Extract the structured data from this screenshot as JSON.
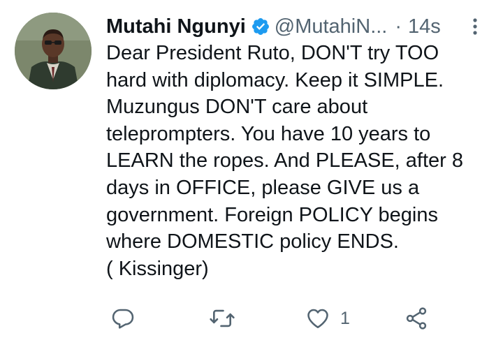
{
  "tweet": {
    "author": {
      "display_name": "Mutahi Ngunyi",
      "handle": "@MutahiN...",
      "verified": true,
      "avatar_icon": "profile-photo"
    },
    "separator": "·",
    "timestamp": "14s",
    "text_lines": [
      "Dear President Ruto, DON'T try TOO",
      "hard with diplomacy. Keep it SIMPLE.",
      "Muzungus DON'T care about",
      "teleprompters. You have 10 years to",
      "LEARN the ropes. And PLEASE, after 8",
      "days in OFFICE, please GIVE us a",
      "government. Foreign POLICY begins",
      "where DOMESTIC policy ENDS.",
      "( Kissinger)"
    ],
    "actions": {
      "reply": {
        "icon": "reply-icon",
        "count": ""
      },
      "retweet": {
        "icon": "retweet-icon",
        "count": ""
      },
      "like": {
        "icon": "heart-icon",
        "count": "1"
      },
      "share": {
        "icon": "share-icon",
        "count": ""
      }
    }
  },
  "colors": {
    "text": "#0f1419",
    "secondary": "#536471",
    "verified_badge": "#1d9bf0",
    "background": "#ffffff"
  }
}
